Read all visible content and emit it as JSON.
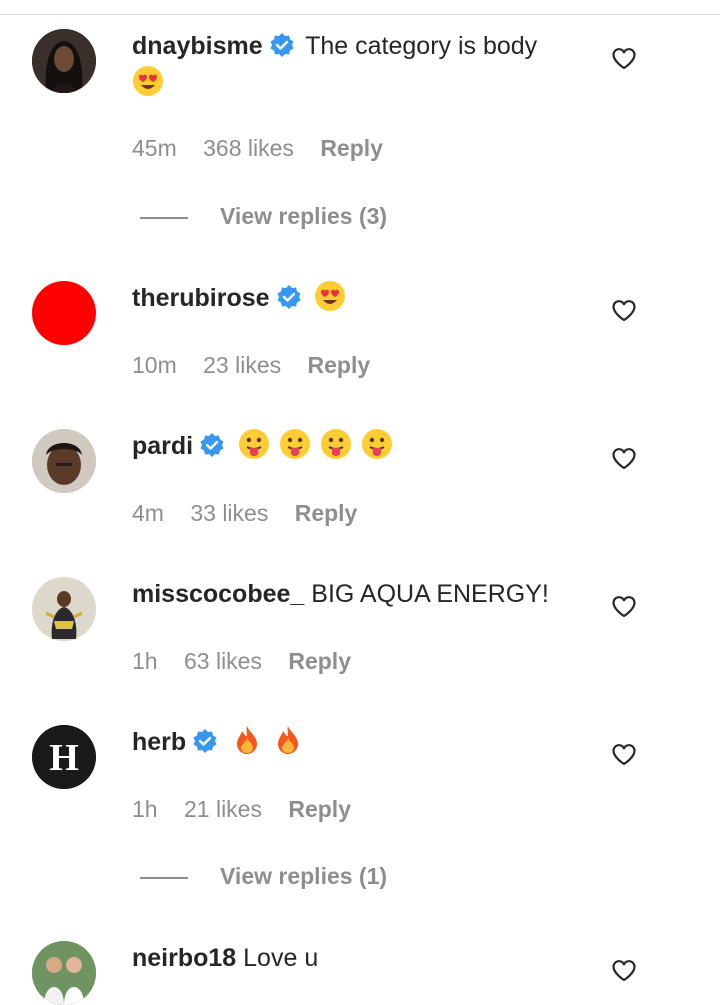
{
  "comments": [
    {
      "username": "dnaybisme",
      "verified": true,
      "text": "The category is body",
      "emojis": [
        "heart-eyes"
      ],
      "time": "45m",
      "likes": "368 likes",
      "reply_label": "Reply",
      "view_replies": "View replies (3)"
    },
    {
      "username": "therubirose",
      "verified": true,
      "text": "",
      "emojis": [
        "heart-eyes"
      ],
      "time": "10m",
      "likes": "23 likes",
      "reply_label": "Reply"
    },
    {
      "username": "pardi",
      "verified": true,
      "text": "",
      "emojis": [
        "tongue-out",
        "tongue-out",
        "tongue-out",
        "tongue-out"
      ],
      "time": "4m",
      "likes": "33 likes",
      "reply_label": "Reply"
    },
    {
      "username": "misscocobee_",
      "verified": false,
      "text": "BIG AQUA ENERGY!",
      "emojis": [],
      "time": "1h",
      "likes": "63 likes",
      "reply_label": "Reply"
    },
    {
      "username": "herb",
      "verified": true,
      "text": "",
      "emojis": [
        "fire",
        "fire"
      ],
      "time": "1h",
      "likes": "21 likes",
      "reply_label": "Reply",
      "view_replies": "View replies (1)",
      "avatar_letter": "H"
    },
    {
      "username": "neirbo18",
      "verified": false,
      "text": "Love u",
      "emojis": []
    }
  ],
  "colors": {
    "verified_badge": "#3897f0",
    "meta_text": "#8e8e8e",
    "username": "#262626",
    "avatar_red": "#ff0000",
    "avatar_herb": "#1a1a1a"
  }
}
